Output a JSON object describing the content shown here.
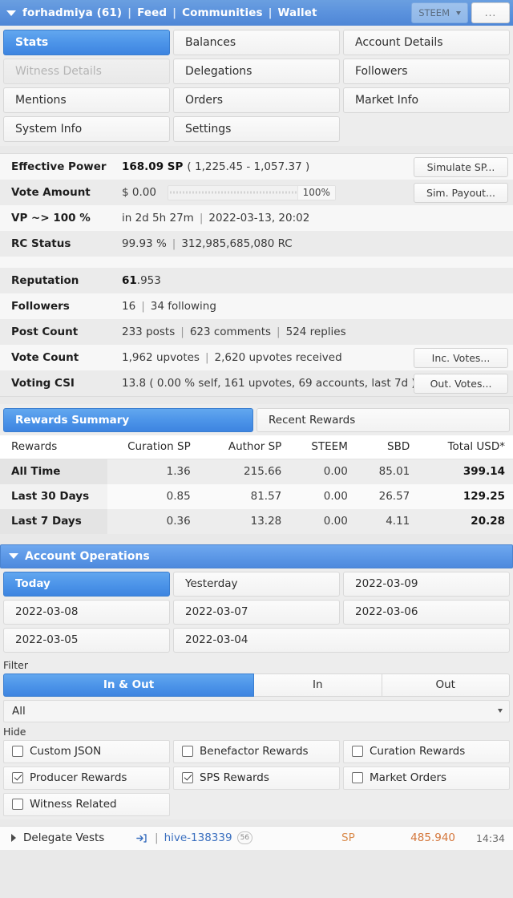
{
  "topbar": {
    "account": "forhadmiya (61)",
    "links": [
      "Feed",
      "Communities",
      "Wallet"
    ],
    "separator": "|",
    "currency": "STEEM",
    "more": "..."
  },
  "tabs": [
    {
      "label": "Stats",
      "state": "active"
    },
    {
      "label": "Balances",
      "state": "normal"
    },
    {
      "label": "Account Details",
      "state": "normal"
    },
    {
      "label": "Witness Details",
      "state": "disabled"
    },
    {
      "label": "Delegations",
      "state": "normal"
    },
    {
      "label": "Followers",
      "state": "normal"
    },
    {
      "label": "Mentions",
      "state": "normal"
    },
    {
      "label": "Orders",
      "state": "normal"
    },
    {
      "label": "Market Info",
      "state": "normal"
    },
    {
      "label": "System Info",
      "state": "normal"
    },
    {
      "label": "Settings",
      "state": "normal"
    },
    {
      "label": "",
      "state": "empty"
    }
  ],
  "stats": {
    "effective_power": {
      "label": "Effective Power",
      "value_bold": "168.09 SP",
      "value_rest": "( 1,225.45 - 1,057.37 )",
      "button": "Simulate SP..."
    },
    "vote_amount": {
      "label": "Vote Amount",
      "value": "$ 0.00",
      "percent": "100%",
      "button": "Sim. Payout..."
    },
    "vp": {
      "label": "VP ~> 100 %",
      "time_left": "in 2d 5h 27m",
      "datetime": "2022-03-13, 20:02"
    },
    "rc": {
      "label": "RC Status",
      "percent": "99.93 %",
      "amount": "312,985,685,080 RC"
    },
    "reputation": {
      "label": "Reputation",
      "value_bold": "61",
      "value_rest": ".953"
    },
    "followers": {
      "label": "Followers",
      "count": "16",
      "following": "34 following"
    },
    "post_count": {
      "label": "Post Count",
      "posts": "233 posts",
      "comments": "623 comments",
      "replies": "524 replies"
    },
    "vote_count": {
      "label": "Vote Count",
      "upvotes": "1,962 upvotes",
      "received": "2,620 upvotes received",
      "button": "Inc. Votes..."
    },
    "voting_csi": {
      "label": "Voting CSI",
      "value": "13.8 ( 0.00 % self, 161 upvotes, 69 accounts, last 7d )",
      "button": "Out. Votes..."
    }
  },
  "rewards_tabs": [
    {
      "label": "Rewards Summary",
      "state": "active"
    },
    {
      "label": "Recent Rewards",
      "state": "normal"
    }
  ],
  "rewards_table": {
    "columns": [
      "Rewards",
      "Curation SP",
      "Author SP",
      "STEEM",
      "SBD",
      "Total USD*"
    ],
    "rows": [
      {
        "period": "All Time",
        "curation_sp": "1.36",
        "author_sp": "215.66",
        "steem": "0.00",
        "sbd": "85.01",
        "total_usd": "399.14"
      },
      {
        "period": "Last 30 Days",
        "curation_sp": "0.85",
        "author_sp": "81.57",
        "steem": "0.00",
        "sbd": "26.57",
        "total_usd": "129.25"
      },
      {
        "period": "Last 7 Days",
        "curation_sp": "0.36",
        "author_sp": "13.28",
        "steem": "0.00",
        "sbd": "4.11",
        "total_usd": "20.28"
      }
    ]
  },
  "account_operations": {
    "title": "Account Operations",
    "dates": [
      {
        "label": "Today",
        "state": "active"
      },
      {
        "label": "Yesterday",
        "state": "normal"
      },
      {
        "label": "2022-03-09",
        "state": "normal"
      },
      {
        "label": "2022-03-08",
        "state": "normal"
      },
      {
        "label": "2022-03-07",
        "state": "normal"
      },
      {
        "label": "2022-03-06",
        "state": "normal"
      },
      {
        "label": "2022-03-05",
        "state": "normal"
      },
      {
        "label": "2022-03-04",
        "state": "normal"
      }
    ],
    "filter_label": "Filter",
    "filter_segments": [
      {
        "label": "In & Out",
        "state": "active"
      },
      {
        "label": "In",
        "state": "normal"
      },
      {
        "label": "Out",
        "state": "normal"
      }
    ],
    "filter_select_value": "All",
    "hide_label": "Hide",
    "hide_options": [
      {
        "label": "Custom JSON",
        "checked": false
      },
      {
        "label": "Benefactor Rewards",
        "checked": false
      },
      {
        "label": "Curation Rewards",
        "checked": false
      },
      {
        "label": "Producer Rewards",
        "checked": true
      },
      {
        "label": "SPS Rewards",
        "checked": true
      },
      {
        "label": "Market Orders",
        "checked": false
      },
      {
        "label": "Witness Related",
        "checked": false
      }
    ],
    "operations": [
      {
        "name": "Delegate Vests",
        "icon": "login-arrow-icon",
        "target": "hive-138339",
        "badge": "56",
        "symbol": "SP",
        "amount": "485.940",
        "time": "14:34"
      }
    ]
  },
  "colors": {
    "accent_blue": "#4b93e8",
    "header_blue": "#5b92dd",
    "amount_orange": "#d4763a",
    "link_blue": "#3a6fbf"
  }
}
